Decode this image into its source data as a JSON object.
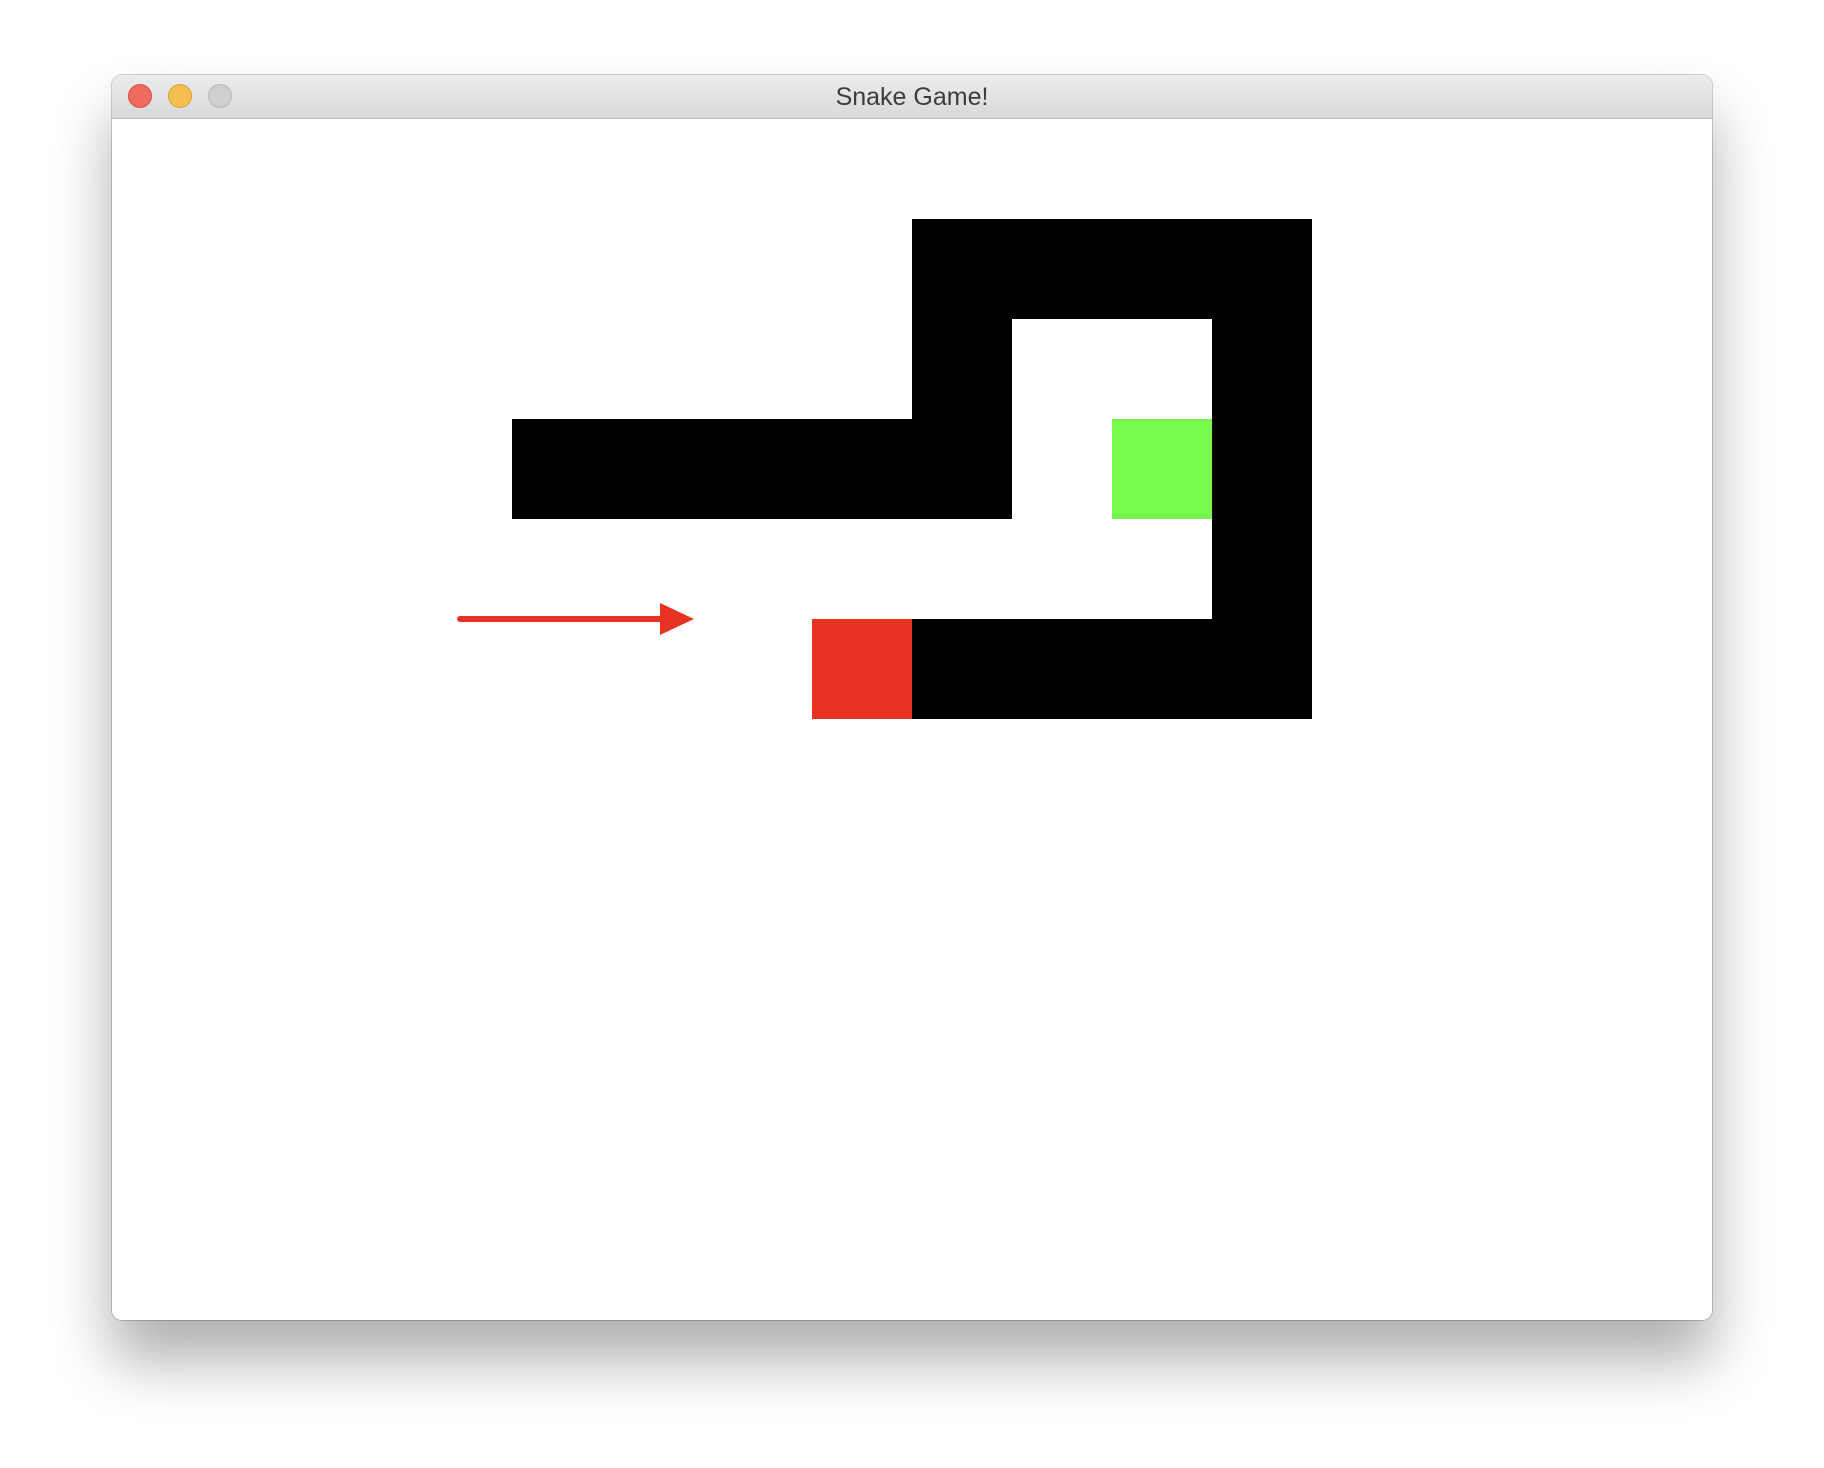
{
  "window": {
    "title": "Snake Game!"
  },
  "game": {
    "grid_unit": 100,
    "snake_color": "#000000",
    "head_color": "#e83323",
    "food_color": "#77fa4d",
    "direction": "right",
    "direction_arrow_color": "#e83323",
    "snake_cells": [
      [
        2,
        2
      ],
      [
        3,
        2
      ],
      [
        4,
        2
      ],
      [
        5,
        2
      ],
      [
        6,
        2
      ],
      [
        6,
        1
      ],
      [
        6,
        0
      ],
      [
        7,
        0
      ],
      [
        8,
        0
      ],
      [
        9,
        0
      ],
      [
        9,
        1
      ],
      [
        9,
        2
      ],
      [
        9,
        3
      ],
      [
        9,
        4
      ],
      [
        8,
        4
      ],
      [
        7,
        4
      ],
      [
        6,
        4
      ]
    ],
    "head_cell": [
      5,
      4
    ],
    "food_cell": [
      8,
      2
    ]
  }
}
